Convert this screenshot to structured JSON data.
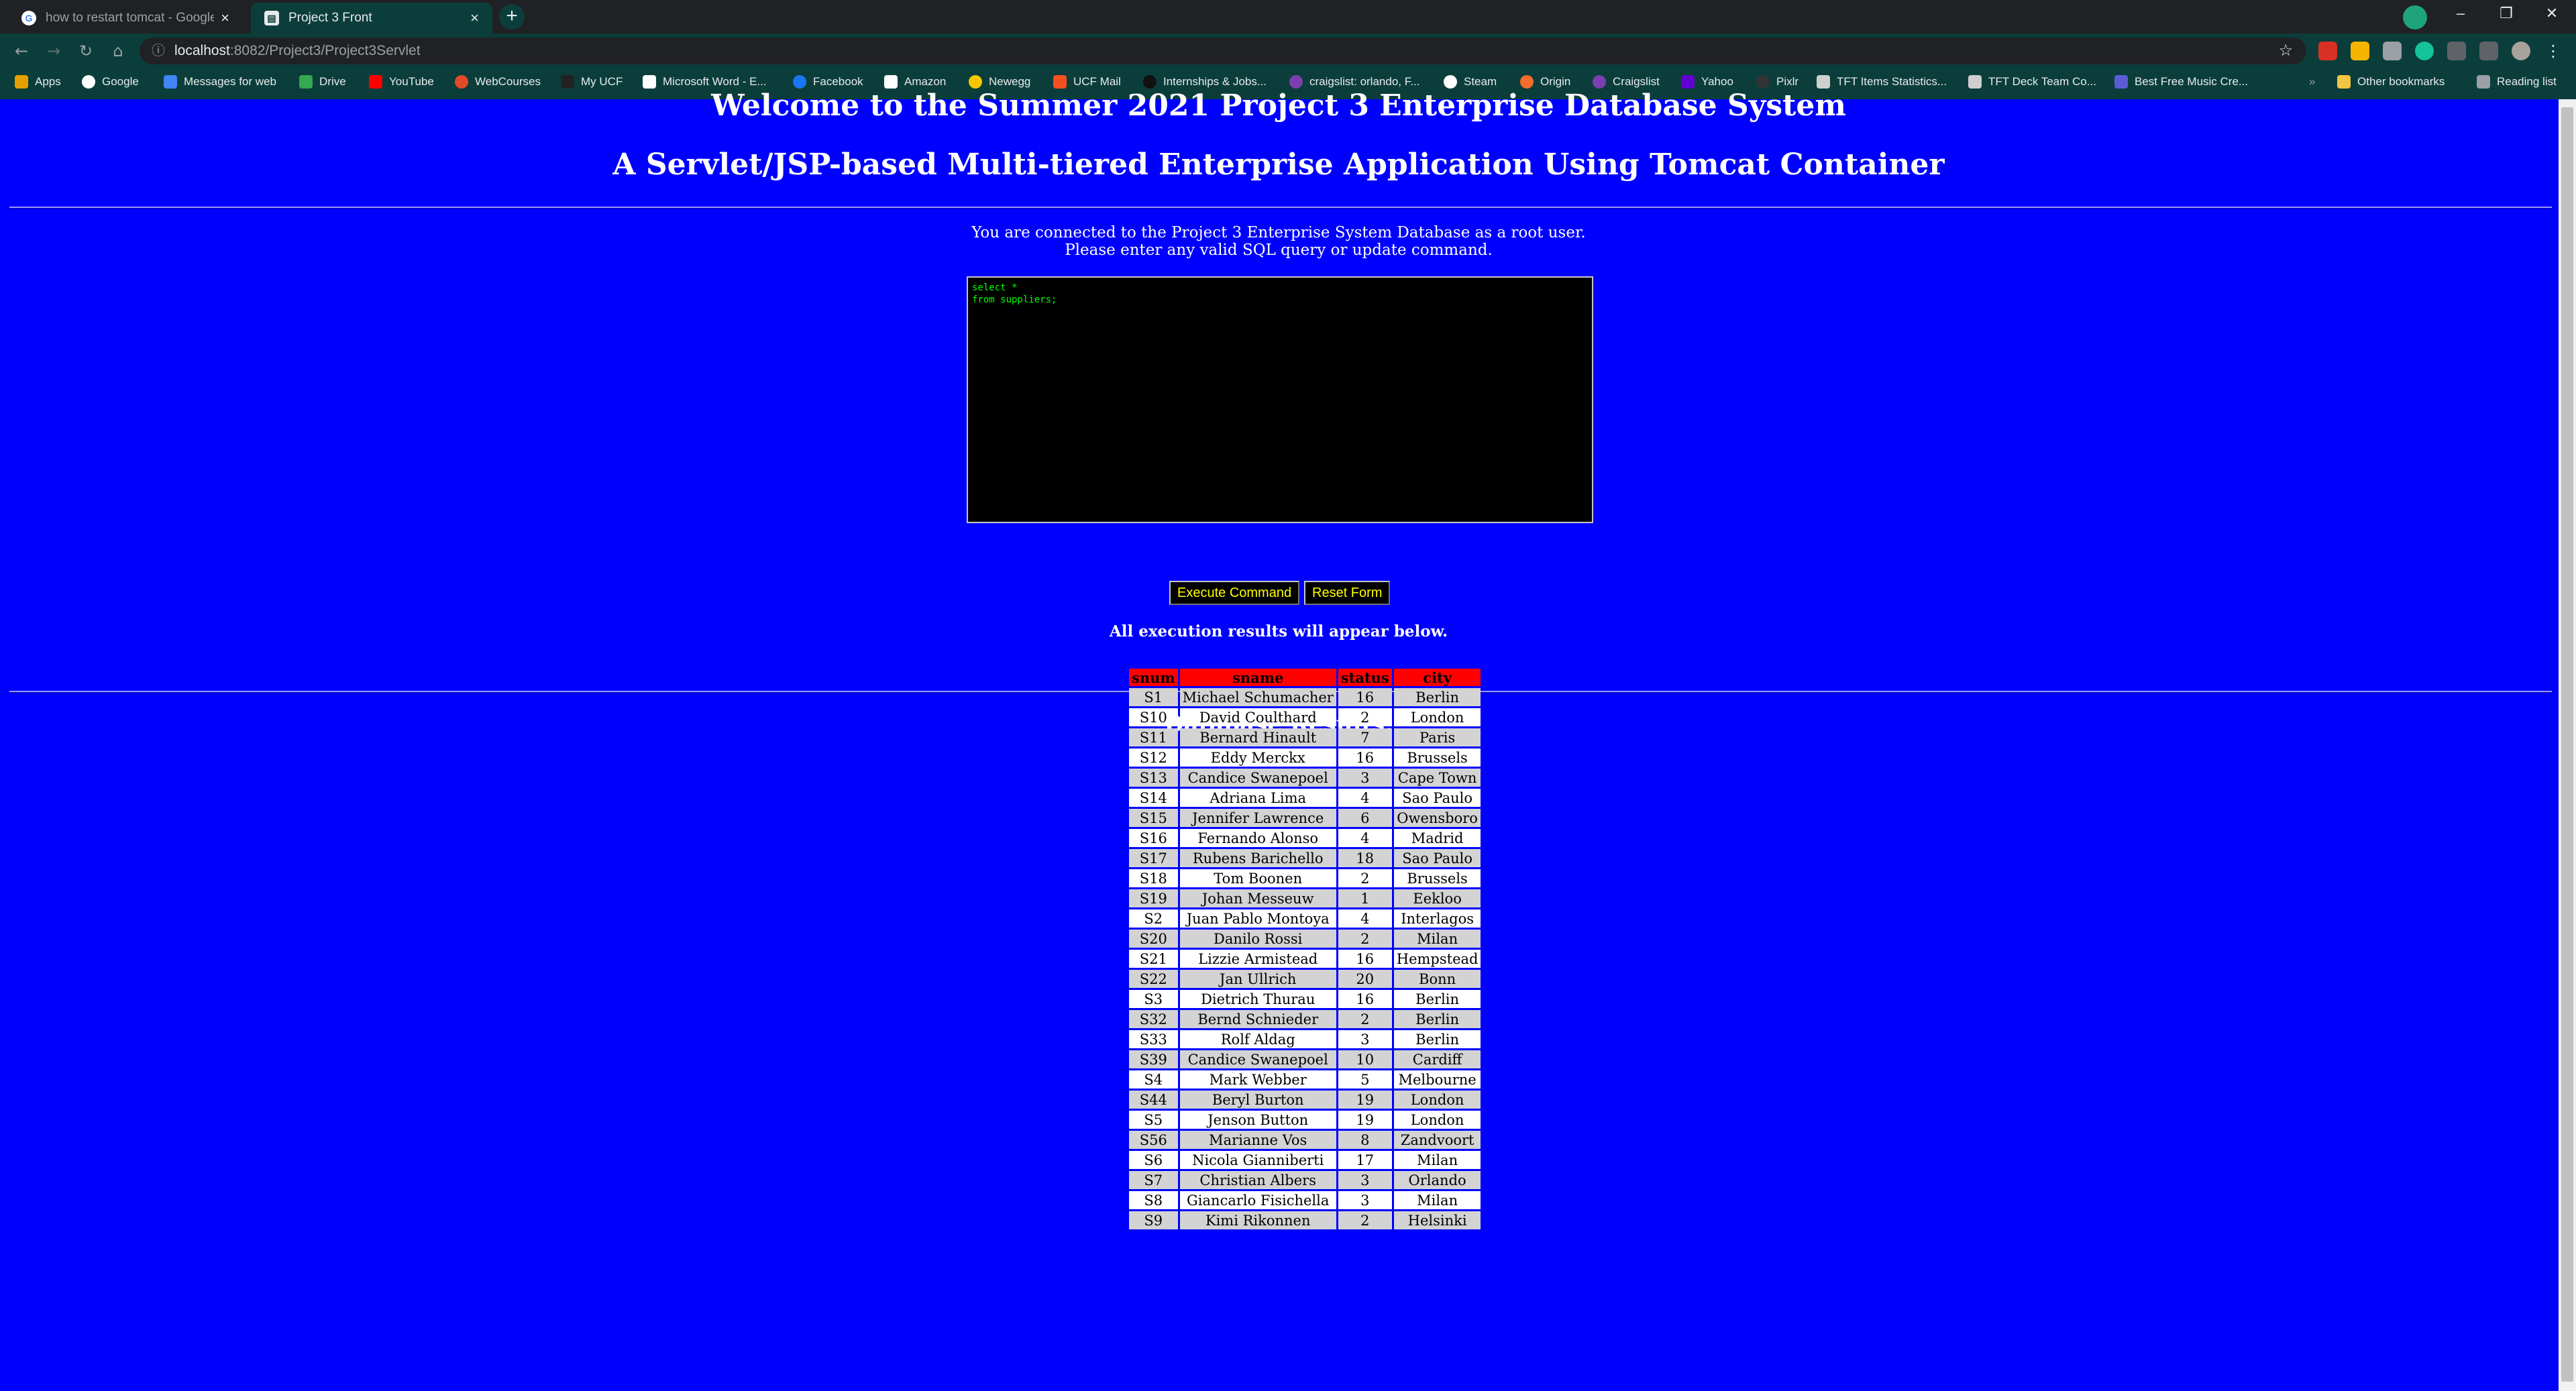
{
  "browser": {
    "tabs": [
      {
        "title": "how to restart tomcat - Google S",
        "active": false,
        "icon": "google-icon"
      },
      {
        "title": "Project 3 Front",
        "active": true,
        "icon": "page-icon"
      }
    ],
    "new_tab_label": "+",
    "url_host": "localhost",
    "url_path": ":8082/Project3/Project3Servlet",
    "window_controls": {
      "minimize": "–",
      "maximize": "❐",
      "close": "✕"
    },
    "bookmarks": [
      {
        "label": "Apps",
        "icon": "apps-grid-icon",
        "color": "#e8a000"
      },
      {
        "label": "Google",
        "icon": "google-icon",
        "color": "#ffffff"
      },
      {
        "label": "Messages for web",
        "icon": "messages-icon",
        "color": "#4285f4"
      },
      {
        "label": "Drive",
        "icon": "drive-icon",
        "color": "#34a853"
      },
      {
        "label": "YouTube",
        "icon": "youtube-icon",
        "color": "#ff0000"
      },
      {
        "label": "WebCourses",
        "icon": "webcourses-icon",
        "color": "#e24a2b"
      },
      {
        "label": "My UCF",
        "icon": "ucf-icon",
        "color": "#222222"
      },
      {
        "label": "Microsoft Word - E...",
        "icon": "word-icon",
        "color": "#ffffff"
      },
      {
        "label": "Facebook",
        "icon": "facebook-icon",
        "color": "#1877f2"
      },
      {
        "label": "Amazon",
        "icon": "amazon-icon",
        "color": "#ffffff"
      },
      {
        "label": "Newegg",
        "icon": "newegg-icon",
        "color": "#f7c600"
      },
      {
        "label": "UCF Mail",
        "icon": "mail-icon",
        "color": "#f25022"
      },
      {
        "label": "Internships & Jobs...",
        "icon": "handshake-icon",
        "color": "#111111"
      },
      {
        "label": "craigslist: orlando, F...",
        "icon": "craigslist-icon",
        "color": "#7b3fb0"
      },
      {
        "label": "Steam",
        "icon": "steam-icon",
        "color": "#ffffff"
      },
      {
        "label": "Origin",
        "icon": "origin-icon",
        "color": "#f56c2d"
      },
      {
        "label": "Craigslist",
        "icon": "craigslist-icon",
        "color": "#7b3fb0"
      },
      {
        "label": "Yahoo",
        "icon": "yahoo-icon",
        "color": "#6001d2"
      },
      {
        "label": "Pixlr",
        "icon": "pixlr-icon",
        "color": "#333333"
      },
      {
        "label": "TFT Items Statistics...",
        "icon": "tft-icon",
        "color": "#cfcfcf"
      },
      {
        "label": "TFT Deck Team Co...",
        "icon": "tft-icon",
        "color": "#cfcfcf"
      },
      {
        "label": "Best Free Music Cre...",
        "icon": "music-icon",
        "color": "#5b5bd6"
      }
    ],
    "other_bookmarks": "Other bookmarks",
    "reading_list": "Reading list"
  },
  "page": {
    "heading_welcome": "Welcome to the Summer 2021 Project 3 Enterprise Database System",
    "heading_sub": "A Servlet/JSP-based Multi-tiered Enterprise Application Using Tomcat Container",
    "intro_line1": "You are connected to the Project 3 Enterprise System Database as a root user.",
    "intro_line2": "Please enter any valid SQL query or update command.",
    "sql_text": "select *\nfrom suppliers;",
    "execute_button": "Execute Command",
    "reset_button": "Reset Form",
    "results_note": "All execution results will appear below.",
    "results_title": "Database Results:",
    "colors": {
      "background": "#0000ff",
      "header_cell": "#ff0000",
      "button_text": "#ffff00",
      "sql_text": "#00ff00"
    }
  },
  "results_table": {
    "columns": [
      "snum",
      "sname",
      "status",
      "city"
    ],
    "rows": [
      [
        "S1",
        "Michael Schumacher",
        "16",
        "Berlin"
      ],
      [
        "S10",
        "David Coulthard",
        "2",
        "London"
      ],
      [
        "S11",
        "Bernard Hinault",
        "7",
        "Paris"
      ],
      [
        "S12",
        "Eddy Merckx",
        "16",
        "Brussels"
      ],
      [
        "S13",
        "Candice Swanepoel",
        "3",
        "Cape Town"
      ],
      [
        "S14",
        "Adriana Lima",
        "4",
        "Sao Paulo"
      ],
      [
        "S15",
        "Jennifer Lawrence",
        "6",
        "Owensboro"
      ],
      [
        "S16",
        "Fernando Alonso",
        "4",
        "Madrid"
      ],
      [
        "S17",
        "Rubens Barichello",
        "18",
        "Sao Paulo"
      ],
      [
        "S18",
        "Tom Boonen",
        "2",
        "Brussels"
      ],
      [
        "S19",
        "Johan Messeuw",
        "1",
        "Eekloo"
      ],
      [
        "S2",
        "Juan Pablo Montoya",
        "4",
        "Interlagos"
      ],
      [
        "S20",
        "Danilo Rossi",
        "2",
        "Milan"
      ],
      [
        "S21",
        "Lizzie Armistead",
        "16",
        "Hempstead"
      ],
      [
        "S22",
        "Jan Ullrich",
        "20",
        "Bonn"
      ],
      [
        "S3",
        "Dietrich Thurau",
        "16",
        "Berlin"
      ],
      [
        "S32",
        "Bernd Schnieder",
        "2",
        "Berlin"
      ],
      [
        "S33",
        "Rolf Aldag",
        "3",
        "Berlin"
      ],
      [
        "S39",
        "Candice Swanepoel",
        "10",
        "Cardiff"
      ],
      [
        "S4",
        "Mark Webber",
        "5",
        "Melbourne"
      ],
      [
        "S44",
        "Beryl Burton",
        "19",
        "London"
      ],
      [
        "S5",
        "Jenson Button",
        "19",
        "London"
      ],
      [
        "S56",
        "Marianne Vos",
        "8",
        "Zandvoort"
      ],
      [
        "S6",
        "Nicola Gianniberti",
        "17",
        "Milan"
      ],
      [
        "S7",
        "Christian Albers",
        "3",
        "Orlando"
      ],
      [
        "S8",
        "Giancarlo Fisichella",
        "3",
        "Milan"
      ],
      [
        "S9",
        "Kimi Rikonnen",
        "2",
        "Helsinki"
      ]
    ]
  }
}
